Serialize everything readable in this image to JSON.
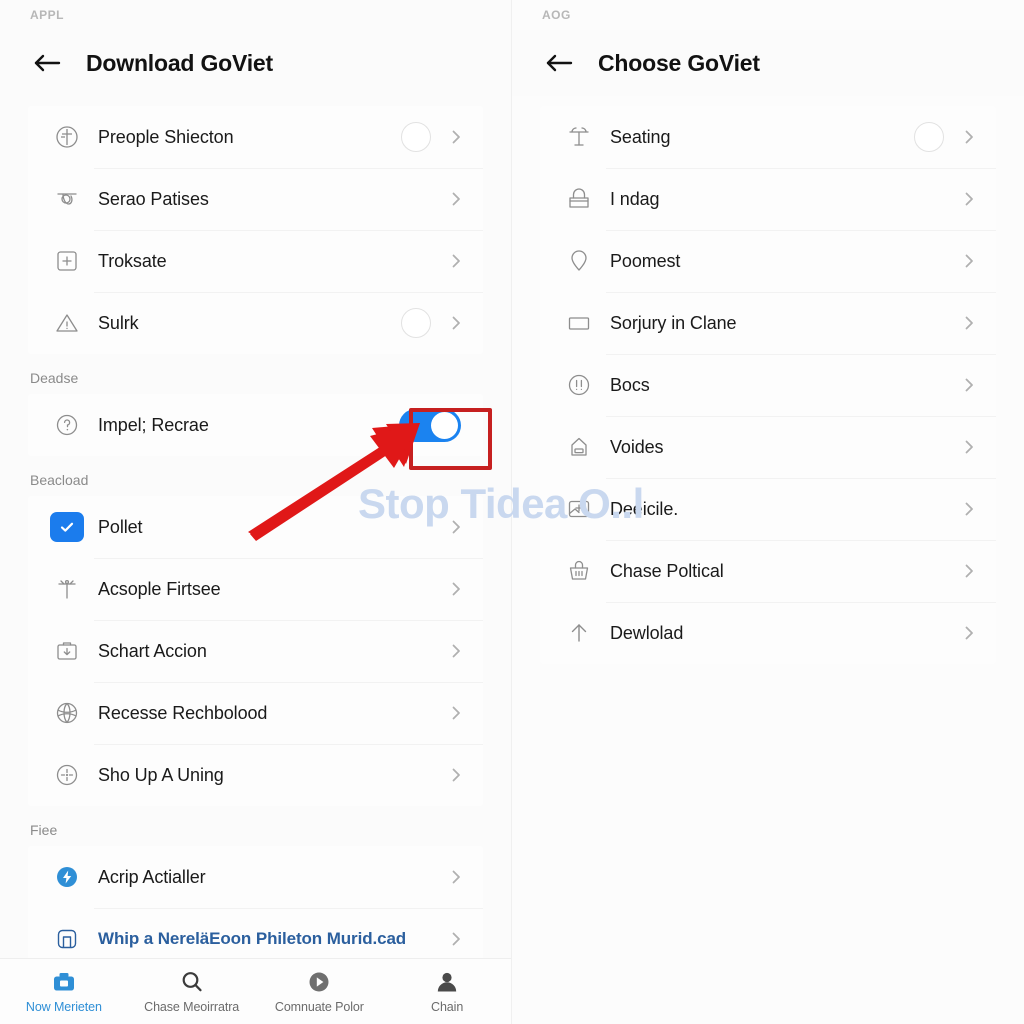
{
  "left": {
    "status_text": "APPL",
    "title": "Download GoViet",
    "back_icon": "arrow-left-icon",
    "group_a": [
      {
        "icon": "gauge-icon",
        "label": "Preople Shiecton",
        "trailing": "circle"
      },
      {
        "icon": "umbrella-icon",
        "label": "Serao Patises",
        "trailing": "none"
      },
      {
        "icon": "plus-box-icon",
        "label": "Troksate",
        "trailing": "none"
      },
      {
        "icon": "warning-icon",
        "label": "Sulrk",
        "trailing": "circle"
      }
    ],
    "section_1_label": "Deadse",
    "group_b": [
      {
        "icon": "help-circle-icon",
        "label": "Impel; Recrae",
        "trailing": "toggle-on"
      }
    ],
    "section_2_label": "Beacload",
    "group_c": [
      {
        "icon": "checkbox-checked-icon",
        "label": "Pollet",
        "trailing": "none"
      },
      {
        "icon": "antenna-icon",
        "label": "Acsople Firtsee",
        "trailing": "none"
      },
      {
        "icon": "briefcase-down-icon",
        "label": "Schart Accion",
        "trailing": "none"
      },
      {
        "icon": "globe-icon",
        "label": "Recesse Rechbolood",
        "trailing": "none"
      },
      {
        "icon": "target-circle-icon",
        "label": "Sho Up A Uning",
        "trailing": "none"
      }
    ],
    "section_3_label": "Fiee",
    "group_d": [
      {
        "icon": "bolt-circle-icon",
        "label": "Acrip Actialler",
        "trailing": "none",
        "style": "normal"
      },
      {
        "icon": "app-square-icon",
        "label": "Whip a NereläEoon Phileton Murid.cad",
        "trailing": "none",
        "style": "link"
      }
    ],
    "bottom_nav": [
      {
        "icon": "briefcase-icon",
        "label": "Now Merieten",
        "active": true
      },
      {
        "icon": "search-icon",
        "label": "Chase Meoirratra",
        "active": false
      },
      {
        "icon": "play-icon",
        "label": "Comnuate Polor",
        "active": false
      },
      {
        "icon": "person-icon",
        "label": "Chain",
        "active": false
      }
    ]
  },
  "right": {
    "status_text": "AOG",
    "title": "Choose GoViet",
    "back_icon": "arrow-left-icon",
    "items": [
      {
        "icon": "table-lamp-icon",
        "label": "Seating",
        "trailing": "circle"
      },
      {
        "icon": "toolbox-icon",
        "label": "I ndag",
        "trailing": "none"
      },
      {
        "icon": "pin-icon",
        "label": "Poomest",
        "trailing": "none"
      },
      {
        "icon": "rectangle-icon",
        "label": "Sorjury in Clane",
        "trailing": "none"
      },
      {
        "icon": "alert-circle-icon",
        "label": "Bocs",
        "trailing": "none"
      },
      {
        "icon": "tag-icon",
        "label": "Voides",
        "trailing": "none"
      },
      {
        "icon": "image-add-icon",
        "label": "Deeicile.",
        "trailing": "none"
      },
      {
        "icon": "basket-icon",
        "label": "Chase Poltical",
        "trailing": "none"
      },
      {
        "icon": "arrow-up-icon",
        "label": "Dewlolad",
        "trailing": "none"
      }
    ]
  },
  "annotation": {
    "highlight_color": "#c62020",
    "arrow_color": "#e01818",
    "highlight_target": "toggle-on-switch"
  },
  "watermark": {
    "text": "Stop Tidea O..l",
    "color": "#c9d8ef"
  }
}
